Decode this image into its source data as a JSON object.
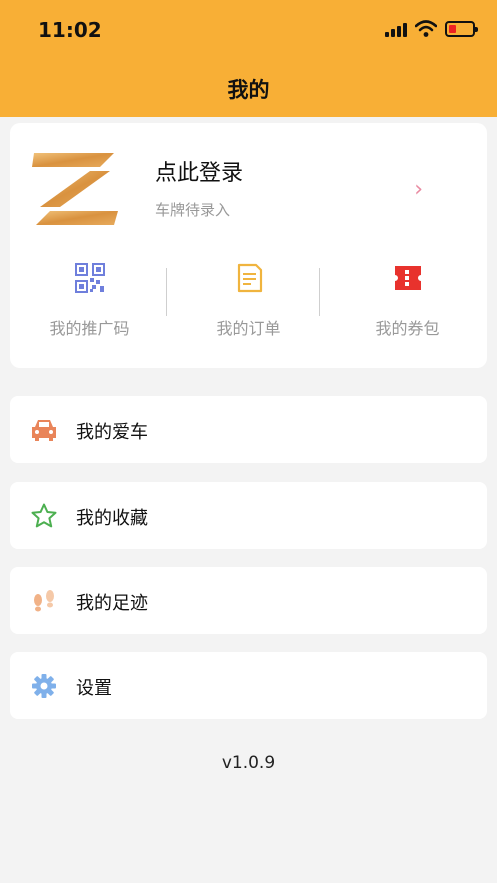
{
  "status_bar": {
    "time": "11:02"
  },
  "header": {
    "title": "我的"
  },
  "profile": {
    "login_text": "点此登录",
    "plate_text": "车牌待录入",
    "chevron": "›"
  },
  "quick_actions": [
    {
      "label": "我的推广码",
      "icon": "qr-code-icon"
    },
    {
      "label": "我的订单",
      "icon": "order-document-icon"
    },
    {
      "label": "我的券包",
      "icon": "ticket-icon"
    }
  ],
  "menu": [
    {
      "label": "我的爱车",
      "icon": "car-icon",
      "color": "#e9855a"
    },
    {
      "label": "我的收藏",
      "icon": "star-icon",
      "color": "#4caf50"
    },
    {
      "label": "我的足迹",
      "icon": "footprints-icon",
      "color": "#f1b287"
    },
    {
      "label": "设置",
      "icon": "gear-icon",
      "color": "#7fb0ea"
    }
  ],
  "version": "v1.0.9",
  "colors": {
    "header": "#f8af36",
    "background": "#f3f3f3"
  }
}
